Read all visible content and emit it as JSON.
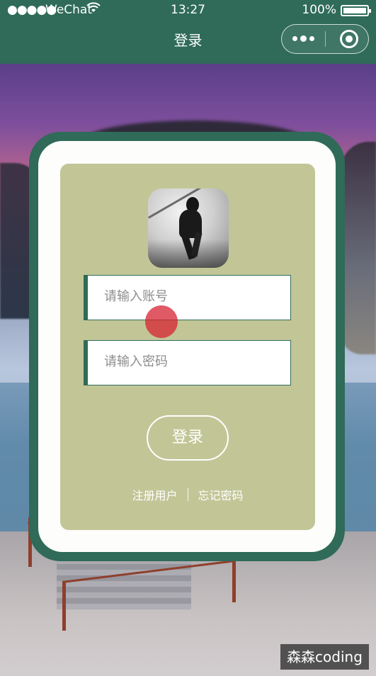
{
  "status_bar": {
    "signal": "●●●●●",
    "carrier": "WeChat",
    "wifi_icon": "wifi-icon",
    "time": "13:27",
    "battery_percent": "100%"
  },
  "nav": {
    "title": "登录"
  },
  "capsule": {
    "more_icon": "more-dots-icon",
    "close_icon": "record-close-icon"
  },
  "login": {
    "account_placeholder": "请输入账号",
    "password_placeholder": "请输入密码",
    "submit_label": "登录",
    "register_link": "注册用户",
    "forgot_link": "忘记密码"
  },
  "watermark": "森森coding",
  "colors": {
    "nav_green": "#2f6b58",
    "card_green": "#c2c697",
    "tap_indicator": "#d62332"
  }
}
